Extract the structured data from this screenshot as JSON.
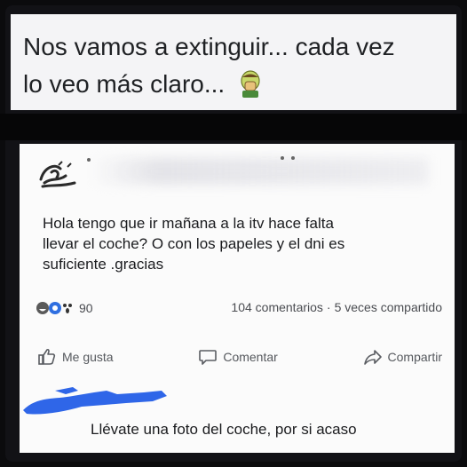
{
  "caption": {
    "line1": "Nos vamos a extinguir... cada vez",
    "line2": "lo veo más claro..."
  },
  "post": {
    "text_line1": "Hola tengo que ir mañana  a la  itv hace falta",
    "text_line2": "llevar el coche? O con los papeles y el dni es",
    "text_line3": "suficiente .gracias",
    "reaction_count": "90",
    "comments": "104 comentarios",
    "shares": "5 veces compartido"
  },
  "actions": {
    "like": "Me gusta",
    "comment": "Comentar",
    "share": "Compartir"
  },
  "reply": {
    "text": "Llévate una foto del coche, por si acaso"
  },
  "colors": {
    "scribble": "#2f66e8",
    "like_reaction": "#2f6fe0",
    "haha_reaction": "#f3c13a"
  }
}
